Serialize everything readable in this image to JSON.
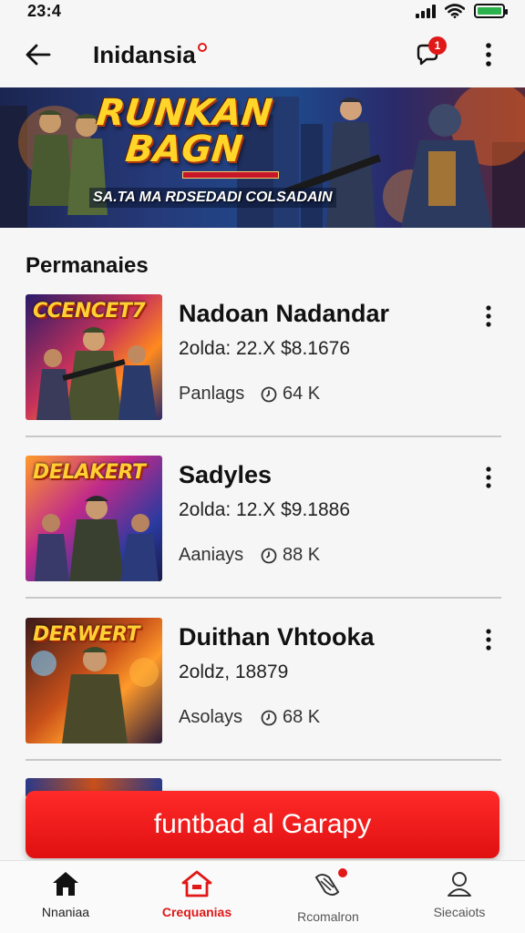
{
  "status": {
    "time": "23:4"
  },
  "app_bar": {
    "title": "Inidansia",
    "notification_count": "1"
  },
  "banner": {
    "title_line1": "RUNKAN",
    "title_line2": "BAGN",
    "tagline": "SA.TA MA RDSEDADI COLSADAIN"
  },
  "section_title": "Permanaies",
  "items": [
    {
      "thumb_text": "CCENCET7",
      "name": "Nadoan Nadandar",
      "price": "2olda: 22.X  $8.1676",
      "type": "Panlags",
      "count": "64 K"
    },
    {
      "thumb_text": "DELAKERT",
      "name": "Sadyles",
      "price": "2olda: 12.X  $9.1886",
      "type": "Aaniays",
      "count": "88 K"
    },
    {
      "thumb_text": "DERWERT",
      "name": "Duithan Vhtooka",
      "price": "2oldz, 18879",
      "type": "Asolays",
      "count": "68 K"
    }
  ],
  "cta_label": "funtbad al Garapy",
  "bottom_nav": [
    {
      "label": "Nnaniaa",
      "icon": "home-icon"
    },
    {
      "label": "Crequanias",
      "icon": "store-icon"
    },
    {
      "label": "Rcomalron",
      "icon": "chat-icon"
    },
    {
      "label": "Siecaiots",
      "icon": "profile-icon"
    }
  ],
  "colors": {
    "accent": "#e01818",
    "battery": "#2bb24c"
  }
}
